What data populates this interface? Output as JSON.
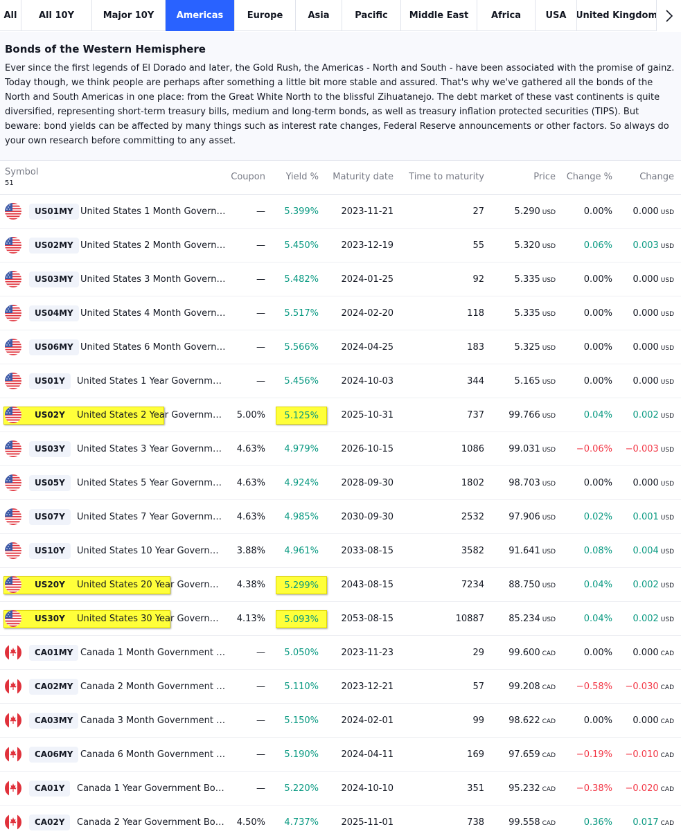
{
  "tabs": [
    {
      "label": "All",
      "active": false
    },
    {
      "label": "All 10Y",
      "active": false
    },
    {
      "label": "Major 10Y",
      "active": false
    },
    {
      "label": "Americas",
      "active": true
    },
    {
      "label": "Europe",
      "active": false
    },
    {
      "label": "Asia",
      "active": false
    },
    {
      "label": "Pacific",
      "active": false
    },
    {
      "label": "Middle East",
      "active": false
    },
    {
      "label": "Africa",
      "active": false
    },
    {
      "label": "USA",
      "active": false
    },
    {
      "label": "United Kingdom",
      "active": false
    }
  ],
  "tab_scroll_icon": "chevron-right-icon",
  "description": {
    "title": "Bonds of the Western Hemisphere",
    "body": "Ever since the first legends of El Dorado and later, the Gold Rush, the Americas - North and South - have been associated with the promise of gainz. Today though, we think people are perhaps after something a little bit more stable and assured. That's why we've gathered all the bonds of the North and South Americas in one place: from the Great White North to the blissful Zihuatanejo. The debt market of these vast continents is quite diversified, representing short-term treasury bills, medium and long-term bonds, as well as treasury inflation protected securities (TIPS). But beware: bond yields can be affected by many things such as interest rate changes, Federal Reserve announcements or other factors. So always do your own research before committing to any asset."
  },
  "table": {
    "headers": {
      "symbol": "Symbol",
      "count": "51",
      "coupon": "Coupon",
      "yield": "Yield %",
      "maturity": "Maturity date",
      "ttm": "Time to maturity",
      "price": "Price",
      "change_pct": "Change %",
      "change": "Change"
    },
    "rows": [
      {
        "flag": "us",
        "ticker": "US01MY",
        "name": "United States 1 Month Govern…",
        "coupon": "—",
        "yield": "5.399%",
        "maturity": "2023-11-21",
        "ttm": "27",
        "price": "5.290",
        "currency": "USD",
        "change_pct": "0.00%",
        "change": "0.000",
        "dir": "neu",
        "highlight": false
      },
      {
        "flag": "us",
        "ticker": "US02MY",
        "name": "United States 2 Month Govern…",
        "coupon": "—",
        "yield": "5.450%",
        "maturity": "2023-12-19",
        "ttm": "55",
        "price": "5.320",
        "currency": "USD",
        "change_pct": "0.06%",
        "change": "0.003",
        "dir": "pos",
        "highlight": false
      },
      {
        "flag": "us",
        "ticker": "US03MY",
        "name": "United States 3 Month Govern…",
        "coupon": "—",
        "yield": "5.482%",
        "maturity": "2024-01-25",
        "ttm": "92",
        "price": "5.335",
        "currency": "USD",
        "change_pct": "0.00%",
        "change": "0.000",
        "dir": "neu",
        "highlight": false
      },
      {
        "flag": "us",
        "ticker": "US04MY",
        "name": "United States 4 Month Govern…",
        "coupon": "—",
        "yield": "5.517%",
        "maturity": "2024-02-20",
        "ttm": "118",
        "price": "5.335",
        "currency": "USD",
        "change_pct": "0.00%",
        "change": "0.000",
        "dir": "neu",
        "highlight": false
      },
      {
        "flag": "us",
        "ticker": "US06MY",
        "name": "United States 6 Month Govern…",
        "coupon": "—",
        "yield": "5.566%",
        "maturity": "2024-04-25",
        "ttm": "183",
        "price": "5.325",
        "currency": "USD",
        "change_pct": "0.00%",
        "change": "0.000",
        "dir": "neu",
        "highlight": false
      },
      {
        "flag": "us",
        "ticker": "US01Y",
        "name": "United States 1 Year Governm…",
        "coupon": "—",
        "yield": "5.456%",
        "maturity": "2024-10-03",
        "ttm": "344",
        "price": "5.165",
        "currency": "USD",
        "change_pct": "0.00%",
        "change": "0.000",
        "dir": "neu",
        "highlight": false
      },
      {
        "flag": "us",
        "ticker": "US02Y",
        "name": "United States 2 Year Governm…",
        "name_hl": "United States 2 Year",
        "name_rest": " Governm…",
        "coupon": "5.00%",
        "yield": "5.125%",
        "maturity": "2025-10-31",
        "ttm": "737",
        "price": "99.766",
        "currency": "USD",
        "change_pct": "0.04%",
        "change": "0.002",
        "dir": "pos",
        "highlight": true
      },
      {
        "flag": "us",
        "ticker": "US03Y",
        "name": "United States 3 Year Governm…",
        "coupon": "4.63%",
        "yield": "4.979%",
        "maturity": "2026-10-15",
        "ttm": "1086",
        "price": "99.031",
        "currency": "USD",
        "change_pct": "−0.06%",
        "change": "−0.003",
        "dir": "neg",
        "highlight": false
      },
      {
        "flag": "us",
        "ticker": "US05Y",
        "name": "United States 5 Year Governm…",
        "coupon": "4.63%",
        "yield": "4.924%",
        "maturity": "2028-09-30",
        "ttm": "1802",
        "price": "98.703",
        "currency": "USD",
        "change_pct": "0.00%",
        "change": "0.000",
        "dir": "neu",
        "highlight": false
      },
      {
        "flag": "us",
        "ticker": "US07Y",
        "name": "United States 7 Year Governm…",
        "coupon": "4.63%",
        "yield": "4.985%",
        "maturity": "2030-09-30",
        "ttm": "2532",
        "price": "97.906",
        "currency": "USD",
        "change_pct": "0.02%",
        "change": "0.001",
        "dir": "pos",
        "highlight": false
      },
      {
        "flag": "us",
        "ticker": "US10Y",
        "name": "United States 10 Year Govern…",
        "coupon": "3.88%",
        "yield": "4.961%",
        "maturity": "2033-08-15",
        "ttm": "3582",
        "price": "91.641",
        "currency": "USD",
        "change_pct": "0.08%",
        "change": "0.004",
        "dir": "pos",
        "highlight": false
      },
      {
        "flag": "us",
        "ticker": "US20Y",
        "name": "United States 20 Year Govern…",
        "name_hl": "United States 20 Year",
        "name_rest": " Govern…",
        "coupon": "4.38%",
        "yield": "5.299%",
        "maturity": "2043-08-15",
        "ttm": "7234",
        "price": "88.750",
        "currency": "USD",
        "change_pct": "0.04%",
        "change": "0.002",
        "dir": "pos",
        "highlight": true
      },
      {
        "flag": "us",
        "ticker": "US30Y",
        "name": "United States 30 Year Govern…",
        "name_hl": "United States 30 Year",
        "name_rest": " Govern…",
        "coupon": "4.13%",
        "yield": "5.093%",
        "maturity": "2053-08-15",
        "ttm": "10887",
        "price": "85.234",
        "currency": "USD",
        "change_pct": "0.04%",
        "change": "0.002",
        "dir": "pos",
        "highlight": true
      },
      {
        "flag": "ca",
        "ticker": "CA01MY",
        "name": "Canada 1 Month Government …",
        "coupon": "—",
        "yield": "5.050%",
        "maturity": "2023-11-23",
        "ttm": "29",
        "price": "99.600",
        "currency": "CAD",
        "change_pct": "0.00%",
        "change": "0.000",
        "dir": "neu",
        "highlight": false
      },
      {
        "flag": "ca",
        "ticker": "CA02MY",
        "name": "Canada 2 Month Government …",
        "coupon": "—",
        "yield": "5.110%",
        "maturity": "2023-12-21",
        "ttm": "57",
        "price": "99.208",
        "currency": "CAD",
        "change_pct": "−0.58%",
        "change": "−0.030",
        "dir": "neg",
        "highlight": false
      },
      {
        "flag": "ca",
        "ticker": "CA03MY",
        "name": "Canada 3 Month Government …",
        "coupon": "—",
        "yield": "5.150%",
        "maturity": "2024-02-01",
        "ttm": "99",
        "price": "98.622",
        "currency": "CAD",
        "change_pct": "0.00%",
        "change": "0.000",
        "dir": "neu",
        "highlight": false
      },
      {
        "flag": "ca",
        "ticker": "CA06MY",
        "name": "Canada 6 Month Government …",
        "coupon": "—",
        "yield": "5.190%",
        "maturity": "2024-04-11",
        "ttm": "169",
        "price": "97.659",
        "currency": "CAD",
        "change_pct": "−0.19%",
        "change": "−0.010",
        "dir": "neg",
        "highlight": false
      },
      {
        "flag": "ca",
        "ticker": "CA01Y",
        "name": "Canada 1 Year Government Bo…",
        "coupon": "—",
        "yield": "5.220%",
        "maturity": "2024-10-10",
        "ttm": "351",
        "price": "95.232",
        "currency": "CAD",
        "change_pct": "−0.38%",
        "change": "−0.020",
        "dir": "neg",
        "highlight": false
      },
      {
        "flag": "ca",
        "ticker": "CA02Y",
        "name": "Canada 2 Year Government Bo…",
        "coupon": "4.50%",
        "yield": "4.737%",
        "maturity": "2025-11-01",
        "ttm": "738",
        "price": "99.558",
        "currency": "CAD",
        "change_pct": "0.36%",
        "change": "0.017",
        "dir": "pos",
        "highlight": false
      }
    ]
  },
  "colors": {
    "accent": "#2962ff",
    "positive": "#089981",
    "negative": "#f23645",
    "highlight": "#ffff00"
  }
}
